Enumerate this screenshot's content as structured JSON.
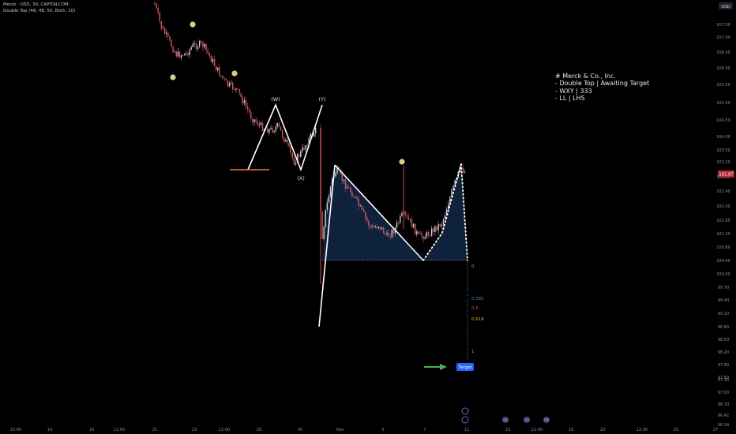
{
  "header": {
    "title": "Merck · USD, 30, CAPITALCOM",
    "indicator": "Double Top (48, 48, 50, Both, 10)"
  },
  "price_axis": {
    "currency": "USD",
    "current_price": "102.87"
  },
  "analysis_note": {
    "lines": [
      "# Merck & Co., Inc.",
      "- Double Top | Awaiting Target",
      "- WXY | 333",
      "- LL | LHS"
    ]
  },
  "target_label": "Target",
  "colors": {
    "background": "#000000",
    "bull_candle": "#c9cdd4",
    "bear_candle": "#d9545c",
    "price_badge": "#b22833",
    "wave_line": "#ffffff",
    "support_line": "#f07f3c",
    "marker_dot": "#d7cf83",
    "pattern_fill": "#10243e",
    "target_arrow": "#4caf50",
    "target_badge": "#2962ff",
    "fib_0382": "#3d7fd9",
    "fib_05": "#d8534f",
    "fib_0618": "#d4b53a"
  },
  "chart_data": {
    "type": "candlestick",
    "title": "Merck · USD, 30, CAPITALCOM",
    "ylim": [
      96.0,
      108.0
    ],
    "y_ticks": [
      "107.50",
      "107.00",
      "106.50",
      "106.00",
      "105.50",
      "105.00",
      "104.50",
      "104.00",
      "103.50",
      "103.20",
      "102.80",
      "102.40",
      "102.00",
      "101.60",
      "101.20",
      "100.80",
      "100.40",
      "100.00",
      "99.70",
      "99.40",
      "99.10",
      "98.80",
      "98.50",
      "98.20",
      "97.90",
      "97.60",
      "97.30",
      "97.00",
      "96.70",
      "96.42",
      "96.14"
    ],
    "x_ticks": [
      "12:00",
      "14",
      "16",
      "12:00",
      "21",
      "23",
      "12:00",
      "28",
      "30",
      "Nov",
      "5",
      "7",
      "11",
      "13",
      "12:00",
      "18",
      "20",
      "12:00",
      "25",
      "27"
    ],
    "fib_levels": [
      {
        "label": "0",
        "value": 0
      },
      {
        "label": "0.382",
        "value": 0.382
      },
      {
        "label": "0.5",
        "value": 0.5
      },
      {
        "label": "0.618",
        "value": 0.618
      },
      {
        "label": "1",
        "value": 1
      }
    ],
    "wave_labels": [
      "(W)",
      "(X)",
      "(Y)"
    ],
    "grid": false
  }
}
